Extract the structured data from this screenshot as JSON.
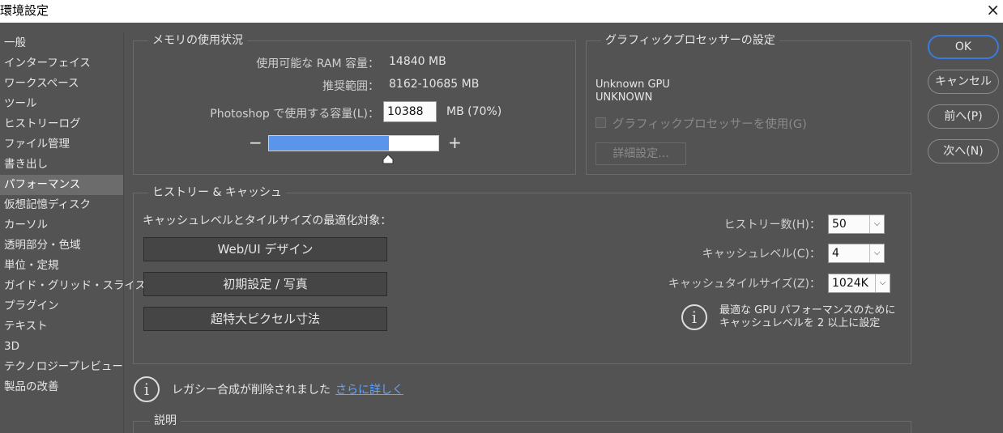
{
  "window": {
    "title": "環境設定",
    "close_glyph": "×"
  },
  "sidebar": {
    "active_index": 7,
    "items": [
      "一般",
      "インターフェイス",
      "ワークスペース",
      "ツール",
      "ヒストリーログ",
      "ファイル管理",
      "書き出し",
      "パフォーマンス",
      "仮想記憶ディスク",
      "カーソル",
      "透明部分・色域",
      "単位・定規",
      "ガイド・グリッド・スライス",
      "プラグイン",
      "テキスト",
      "3D",
      "テクノロジープレビュー",
      "製品の改善"
    ]
  },
  "memory": {
    "legend": "メモリの使用状況",
    "available_label": "使用可能な RAM 容量：",
    "available_value": "14840 MB",
    "recommended_label": "推奨範囲：",
    "recommended_value": "8162-10685 MB",
    "usage_label": "Photoshop で使用する容量(L)：",
    "usage_value": "10388",
    "usage_suffix": "MB (70%)",
    "slider_fraction": 0.7,
    "minus": "−",
    "plus": "+"
  },
  "gpu": {
    "legend": "グラフィックプロセッサーの設定",
    "name_line1": "Unknown GPU",
    "name_line2": "UNKNOWN",
    "use_gpu_label": "グラフィックプロセッサーを使用(G)",
    "advanced_button": "詳細設定..."
  },
  "dialog_buttons": {
    "ok": "OK",
    "cancel": "キャンセル",
    "prev": "前へ(P)",
    "next": "次へ(N)"
  },
  "history_cache": {
    "legend": "ヒストリー & キャッシュ",
    "optimize_label": "キャッシュレベルとタイルサイズの最適化対象：",
    "preset_buttons": [
      "Web/UI デザイン",
      "初期設定 / 写真",
      "超特大ピクセル寸法"
    ],
    "history_states_label": "ヒストリー数(H)：",
    "history_states_value": "50",
    "cache_levels_label": "キャッシュレベル(C)：",
    "cache_levels_value": "4",
    "cache_tile_label": "キャッシュタイルサイズ(Z)：",
    "cache_tile_value": "1024K",
    "info_line1": "最適な GPU パフォーマンスのために",
    "info_line2": "キャッシュレベルを 2 以上に設定",
    "info_glyph": "i"
  },
  "legacy": {
    "message": "レガシー合成が削除されました",
    "link": "さらに詳しく"
  },
  "description": {
    "legend": "説明"
  },
  "colors": {
    "background": "#535353",
    "accent": "#3a7bdc",
    "slider_fill": "#5b95ea",
    "link": "#5fa4ff"
  },
  "chevron_glyph": "⌵"
}
